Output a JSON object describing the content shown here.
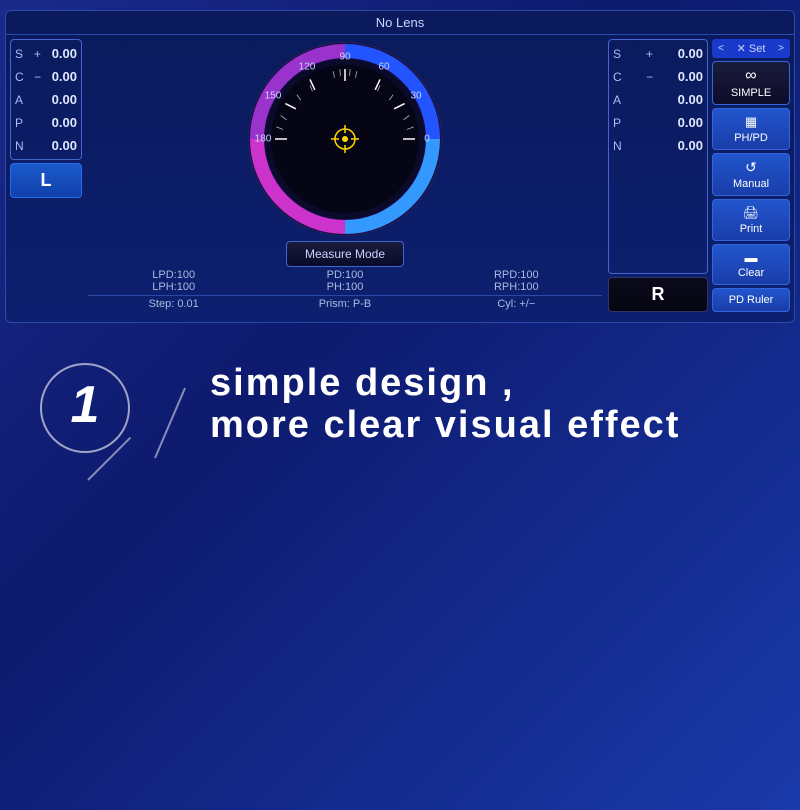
{
  "panel": {
    "title": "No Lens",
    "left": {
      "rows": [
        {
          "label": "S",
          "sign": "+",
          "value": "0.00"
        },
        {
          "label": "C",
          "sign": "−",
          "value": "0.00"
        },
        {
          "label": "A",
          "sign": "",
          "value": "0.00"
        },
        {
          "label": "P",
          "sign": "",
          "value": "0.00"
        },
        {
          "label": "N",
          "sign": "",
          "value": "0.00"
        }
      ],
      "button": "L"
    },
    "right": {
      "rows": [
        {
          "label": "S",
          "sign": "+",
          "value": "0.00"
        },
        {
          "label": "C",
          "sign": "−",
          "value": "0.00"
        },
        {
          "label": "A",
          "sign": "",
          "value": "0.00"
        },
        {
          "label": "P",
          "sign": "",
          "value": "0.00"
        },
        {
          "label": "N",
          "sign": "",
          "value": "0.00"
        }
      ],
      "button": "R"
    },
    "center": {
      "measure_mode": "Measure Mode",
      "stats_row1": [
        "LPD:100",
        "PD:100",
        "RPD:100"
      ],
      "stats_row2": [
        "LPH:100",
        "PH:100",
        "RPH:100"
      ],
      "stats_row3": [
        "Step:  0.01",
        "Prism:  P-B",
        "Cyl:  +/−"
      ]
    },
    "sidebar": {
      "set_bar": "✕  Set",
      "buttons": [
        {
          "icon": "∞",
          "label": "SIMPLE",
          "active": true
        },
        {
          "icon": "▦",
          "label": "PH/PD",
          "active": false
        },
        {
          "icon": "↺",
          "label": "Manual",
          "active": false
        },
        {
          "icon": "⬛",
          "label": "Print",
          "active": false
        },
        {
          "icon": "▬",
          "label": "Clear",
          "active": false
        }
      ],
      "pd_ruler": "PD  Ruler"
    }
  },
  "lower": {
    "number": "1",
    "line1": "simple design ,",
    "line2": "more clear visual effect"
  },
  "gauge": {
    "labels": [
      "90",
      "120",
      "60",
      "150",
      "30",
      "180",
      "0"
    ],
    "tick_major": 30,
    "center_color": "#ffd700"
  }
}
